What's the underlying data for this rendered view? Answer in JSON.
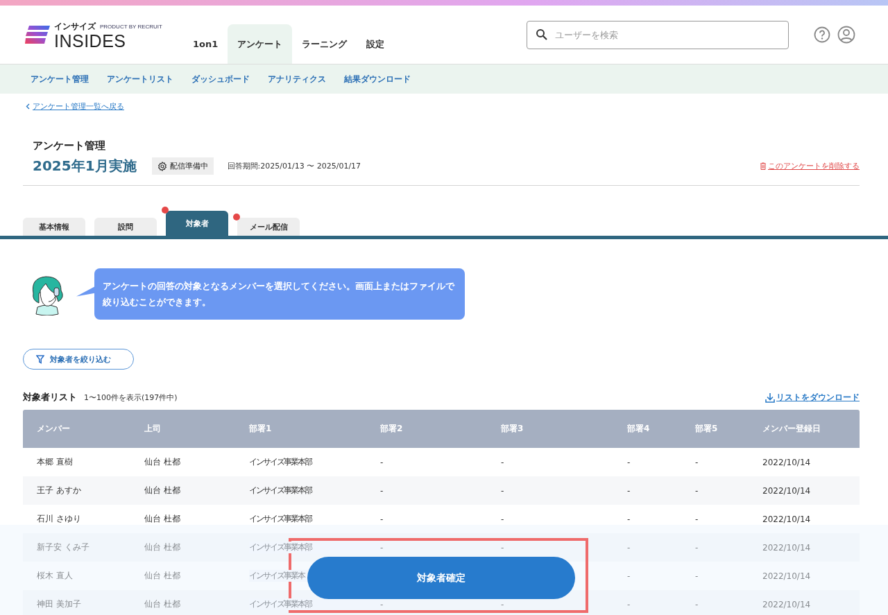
{
  "header": {
    "logo_kana": "インサイズ",
    "logo_product": "PRODUCT BY RECRUIT",
    "logo_text": "INSIDES",
    "nav": [
      {
        "label": "1on1",
        "selected": false
      },
      {
        "label": "アンケート",
        "selected": true
      },
      {
        "label": "ラーニング",
        "selected": false
      },
      {
        "label": "設定",
        "selected": false
      }
    ],
    "search": {
      "placeholder": "ユーザーを検索"
    }
  },
  "subnav": [
    "アンケート管理",
    "アンケートリスト",
    "ダッシュボード",
    "アナリティクス",
    "結果ダウンロード"
  ],
  "back_link": "アンケート管理一覧へ戻る",
  "page": {
    "section": "アンケート管理",
    "title": "2025年1月実施",
    "status": "配信準備中",
    "period": "回答期間:2025/01/13 〜 2025/01/17",
    "delete_link": "このアンケートを削除する"
  },
  "tabs": [
    {
      "label": "基本情報",
      "selected": false,
      "alert": false
    },
    {
      "label": "設問",
      "selected": false,
      "alert": false
    },
    {
      "label": "対象者",
      "selected": true,
      "alert": true
    },
    {
      "label": "メール配信",
      "selected": false,
      "alert": true
    }
  ],
  "guide_message": "アンケートの回答の対象となるメンバーを選択してください。画面上またはファイルで絞り込むことができます。",
  "filter_button": "対象者を絞り込む",
  "list": {
    "title": "対象者リスト",
    "count": "1〜100件を表示(197件中)",
    "download_link": "リストをダウンロード"
  },
  "table": {
    "columns": [
      "メンバー",
      "上司",
      "部署1",
      "部署2",
      "部署3",
      "部署4",
      "部署5",
      "メンバー登録日"
    ],
    "rows": [
      [
        "本郷 直樹",
        "仙台 杜都",
        "インサイズ事業本部",
        "-",
        "-",
        "-",
        "-",
        "2022/10/14"
      ],
      [
        "王子 あすか",
        "仙台 杜都",
        "インサイズ事業本部",
        "-",
        "-",
        "-",
        "-",
        "2022/10/14"
      ],
      [
        "石川 さゆり",
        "仙台 杜都",
        "インサイズ事業本部",
        "-",
        "-",
        "-",
        "-",
        "2022/10/14"
      ],
      [
        "新子安 くみ子",
        "仙台 杜都",
        "インサイズ事業本部",
        "-",
        "-",
        "-",
        "-",
        "2022/10/14"
      ],
      [
        "桜木 直人",
        "仙台 杜都",
        "インサイズ事業本",
        null,
        null,
        "-",
        "-",
        "2022/10/14"
      ],
      [
        "神田 美加子",
        "仙台 杜都",
        "インサイズ事業本部",
        "-",
        "-",
        "-",
        "-",
        "2022/10/14"
      ]
    ]
  },
  "confirm_button": {
    "label": "対象者確定",
    "highlighted": true
  }
}
